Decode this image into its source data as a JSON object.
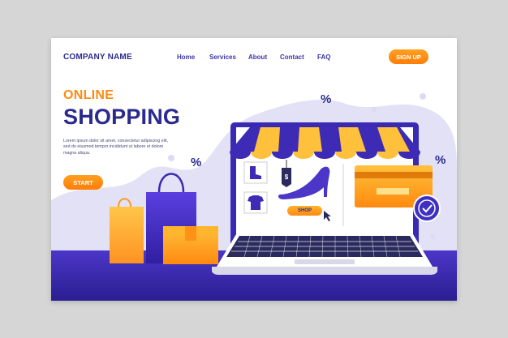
{
  "header": {
    "company_name": "COMPANY NAME",
    "nav": [
      "Home",
      "Services",
      "About",
      "Contact",
      "FAQ"
    ],
    "signup_label": "SIGN UP"
  },
  "hero": {
    "line1": "ONLINE",
    "line2": "SHOPPING",
    "body": "Lorem ipsum dolor sit amet, consectetur adipiscing elit, sed do eiusmod tempor incididunt ut labore et dolore magna aliqua.",
    "start_label": "START"
  },
  "screen": {
    "shop_label": "SHOP",
    "discount_symbol": "%"
  },
  "colors": {
    "brand_blue": "#2b2a8e",
    "accent_orange": "#ff8a10",
    "lavender": "#e3e1f6",
    "page_bg": "#d6d6d6"
  },
  "icons": [
    "boot-icon",
    "tshirt-icon",
    "price-tag-icon",
    "high-heel-icon",
    "credit-card-icon",
    "check-badge-icon",
    "cursor-icon",
    "shopping-bag-icon",
    "box-icon",
    "laptop-icon",
    "awning-icon"
  ]
}
